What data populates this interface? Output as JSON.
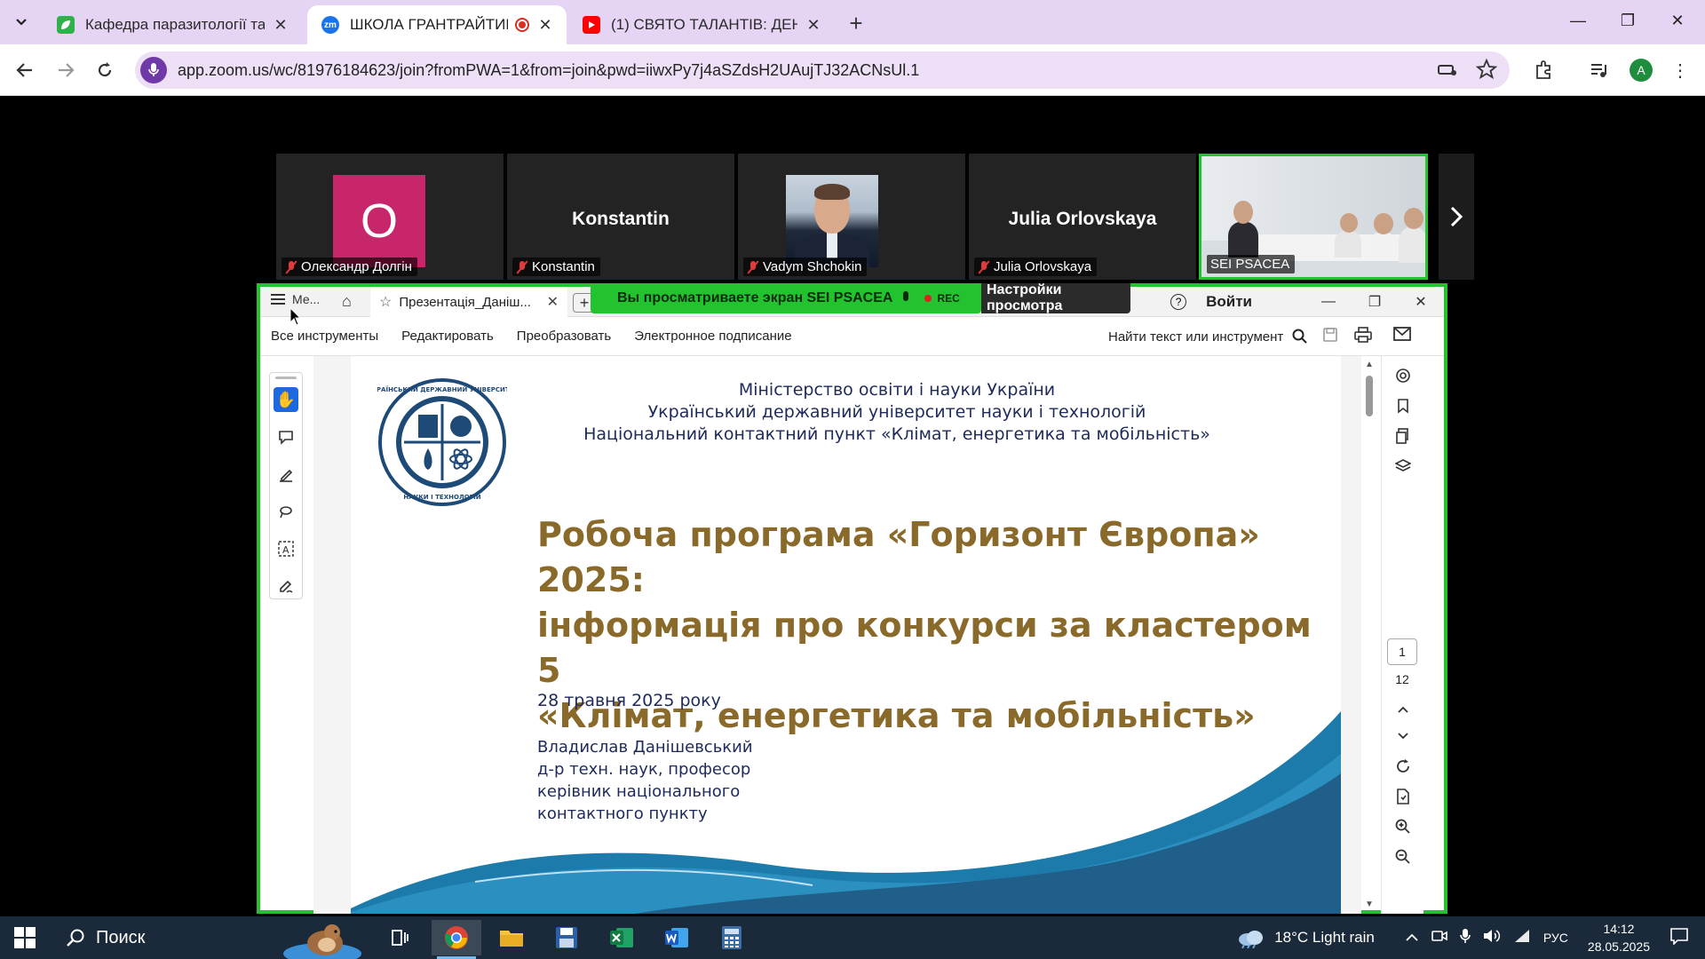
{
  "browser": {
    "tabs": [
      {
        "title": "Кафедра паразитології та вете",
        "icon": "leaf-icon",
        "active": false
      },
      {
        "title": "ШКОЛА ГРАНТРАЙТИНГУ:",
        "icon": "zoom-icon",
        "active": true,
        "recording": true
      },
      {
        "title": "(1) СВЯТО ТАЛАНТІВ: ДЕНЬ ДР",
        "icon": "youtube-icon",
        "active": false
      }
    ],
    "url": "app.zoom.us/wc/81976184623/join?fromPWA=1&from=join&pwd=iiwxPy7j4aSZdsH2UAujTJ32ACNsUl.1",
    "profile_initial": "A"
  },
  "zoom": {
    "participants": [
      {
        "name": "Олександр Долгін",
        "avatar_letter": "O",
        "type": "letter",
        "muted": true
      },
      {
        "name": "Konstantin",
        "display_name": "Konstantin",
        "type": "name",
        "muted": true
      },
      {
        "name": "Vadym Shchokin",
        "type": "photo",
        "muted": true
      },
      {
        "name": "Julia Orlovskaya",
        "display_name": "Julia Orlovskaya",
        "type": "name",
        "muted": true
      },
      {
        "name": "SEI PSACEA",
        "type": "video",
        "muted": false
      }
    ],
    "share_banner": "Вы просматриваете экран  SEI PSACEA",
    "rec_label": "REC",
    "view_settings": "Настройки просмотра"
  },
  "acrobat": {
    "menu_label": "Ме...",
    "tab_title": "Презентація_Даніш...",
    "login_label": "Войти",
    "menu_items": [
      "Все инструменты",
      "Редактировать",
      "Преобразовать",
      "Электронное подписание"
    ],
    "find_label": "Найти текст или инструмент",
    "current_page": "1",
    "total_pages": "12"
  },
  "slide": {
    "header_lines": [
      "Міністерство освіти і науки України",
      "Український державний університет науки і технологій",
      "Національний контактний пункт «Клімат, енергетика та мобільність»"
    ],
    "title_lines": [
      "Робоча програма «Горизонт Європа» 2025:",
      "інформація про конкурси за кластером 5",
      "«Клімат, енергетика та мобільність»"
    ],
    "date": "28 травня 2025 року",
    "author_lines": [
      "Владислав Данішевський",
      "д-р техн. наук, професор",
      "керівник національного",
      "контактного пункту"
    ],
    "logo_text_top": "УКРАЇНСЬКИЙ ДЕРЖАВНИЙ УНІВЕРСИТЕТ",
    "logo_text_bottom": "НАУКИ І ТЕХНОЛОГІЙ"
  },
  "taskbar": {
    "search_label": "Поиск",
    "weather": "18°C  Light rain",
    "lang": "РУС",
    "time": "14:12",
    "date": "28.05.2025"
  },
  "colors": {
    "tabstrip": "#e6d4f5",
    "share_border": "#22c32e",
    "title_gold": "#8a6a2a",
    "navy": "#1e2a5a"
  }
}
